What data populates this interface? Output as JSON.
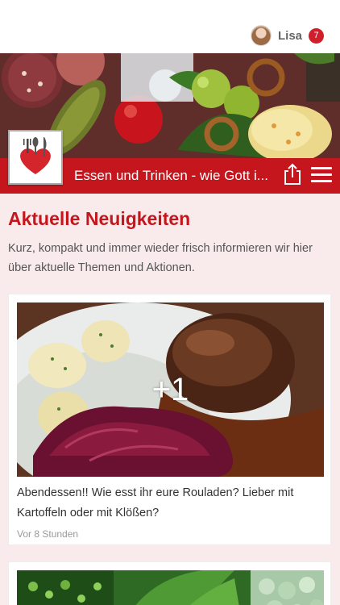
{
  "header": {
    "user_name": "Lisa",
    "notification_count": "7"
  },
  "page": {
    "name": "Essen und Trinken - wie Gott i..."
  },
  "news": {
    "title": "Aktuelle Neuigkeiten",
    "description": "Kurz, kompakt und immer wieder frisch informieren wir hier über aktuelle Themen und Aktionen."
  },
  "posts": [
    {
      "extra_images": "+1",
      "text": "Abendessen!! Wie esst ihr eure Rouladen? Lieber mit Kartoffeln oder mit Klößen?",
      "time": "Vor 8 Stunden"
    }
  ],
  "colors": {
    "brand_red": "#c4161c",
    "background": "#f9ebeb"
  },
  "icons": [
    "avatar",
    "share-icon",
    "hamburger-menu-icon",
    "logo-cutlery-heart-icon"
  ]
}
